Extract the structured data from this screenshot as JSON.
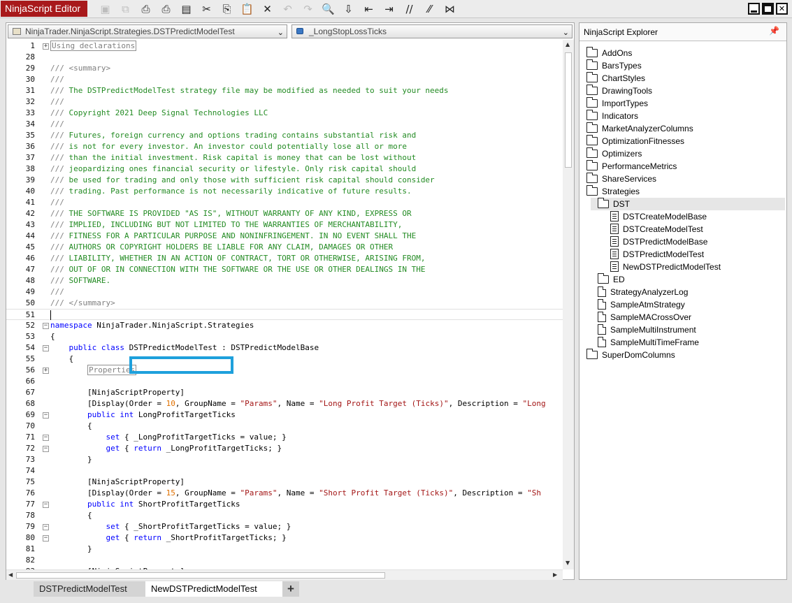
{
  "app": {
    "title": "NinjaScript Editor"
  },
  "toolbar": {
    "items": [
      {
        "name": "save-icon",
        "glyph": "▣"
      },
      {
        "name": "save-all-icon",
        "glyph": "⧉"
      },
      {
        "name": "print-icon",
        "glyph": "⎙"
      },
      {
        "name": "print-preview-icon",
        "glyph": "⎙"
      },
      {
        "name": "document-icon",
        "glyph": "▤"
      },
      {
        "name": "cut-icon",
        "glyph": "✂"
      },
      {
        "name": "copy-icon",
        "glyph": "⎘"
      },
      {
        "name": "paste-icon",
        "glyph": "📋"
      },
      {
        "name": "delete-icon",
        "glyph": "✕"
      },
      {
        "name": "undo-icon",
        "glyph": "↶"
      },
      {
        "name": "redo-icon",
        "glyph": "↷"
      },
      {
        "name": "find-icon",
        "glyph": "🔍"
      },
      {
        "name": "compile-icon",
        "glyph": "⇩"
      },
      {
        "name": "outdent-icon",
        "glyph": "⇤"
      },
      {
        "name": "indent-icon",
        "glyph": "⇥"
      },
      {
        "name": "comment-icon",
        "glyph": "//"
      },
      {
        "name": "uncomment-icon",
        "glyph": "⁄⁄"
      },
      {
        "name": "visual-studio-icon",
        "glyph": "⋈"
      }
    ]
  },
  "editor": {
    "class_combo": "NinjaTrader.NinjaScript.Strategies.DSTPredictModelTest",
    "member_combo": "_LongStopLossTicks",
    "lines": [
      {
        "n": "1",
        "fold": "+",
        "segs": [
          {
            "t": "Using declarations",
            "c": "region"
          }
        ]
      },
      {
        "n": "28",
        "segs": []
      },
      {
        "n": "29",
        "segs": [
          {
            "t": "/// <summary>",
            "c": "cgray"
          }
        ]
      },
      {
        "n": "30",
        "segs": [
          {
            "t": "///",
            "c": "cgray"
          }
        ]
      },
      {
        "n": "31",
        "segs": [
          {
            "t": "/// ",
            "c": "cgray"
          },
          {
            "t": "The DSTPredictModelTest strategy file may be modified as needed to suit your needs",
            "c": "cm"
          }
        ]
      },
      {
        "n": "32",
        "segs": [
          {
            "t": "///",
            "c": "cgray"
          }
        ]
      },
      {
        "n": "33",
        "segs": [
          {
            "t": "/// ",
            "c": "cgray"
          },
          {
            "t": "Copyright 2021 Deep Signal Technologies LLC",
            "c": "cm"
          }
        ]
      },
      {
        "n": "34",
        "segs": [
          {
            "t": "///",
            "c": "cgray"
          }
        ]
      },
      {
        "n": "35",
        "segs": [
          {
            "t": "/// ",
            "c": "cgray"
          },
          {
            "t": "Futures, foreign currency and options trading contains substantial risk and",
            "c": "cm"
          }
        ]
      },
      {
        "n": "36",
        "segs": [
          {
            "t": "/// ",
            "c": "cgray"
          },
          {
            "t": "is not for every investor. An investor could potentially lose all or more",
            "c": "cm"
          }
        ]
      },
      {
        "n": "37",
        "segs": [
          {
            "t": "/// ",
            "c": "cgray"
          },
          {
            "t": "than the initial investment. Risk capital is money that can be lost without",
            "c": "cm"
          }
        ]
      },
      {
        "n": "38",
        "segs": [
          {
            "t": "/// ",
            "c": "cgray"
          },
          {
            "t": "jeopardizing ones financial security or lifestyle. Only risk capital should",
            "c": "cm"
          }
        ]
      },
      {
        "n": "39",
        "segs": [
          {
            "t": "/// ",
            "c": "cgray"
          },
          {
            "t": "be used for trading and only those with sufficient risk capital should consider",
            "c": "cm"
          }
        ]
      },
      {
        "n": "40",
        "segs": [
          {
            "t": "/// ",
            "c": "cgray"
          },
          {
            "t": "trading. Past performance is not necessarily indicative of future results.",
            "c": "cm"
          }
        ]
      },
      {
        "n": "41",
        "segs": [
          {
            "t": "///",
            "c": "cgray"
          }
        ]
      },
      {
        "n": "42",
        "segs": [
          {
            "t": "/// ",
            "c": "cgray"
          },
          {
            "t": "THE SOFTWARE IS PROVIDED \"AS IS\", WITHOUT WARRANTY OF ANY KIND, EXPRESS OR",
            "c": "cm"
          }
        ]
      },
      {
        "n": "43",
        "segs": [
          {
            "t": "/// ",
            "c": "cgray"
          },
          {
            "t": "IMPLIED, INCLUDING BUT NOT LIMITED TO THE WARRANTIES OF MERCHANTABILITY,",
            "c": "cm"
          }
        ]
      },
      {
        "n": "44",
        "segs": [
          {
            "t": "/// ",
            "c": "cgray"
          },
          {
            "t": "FITNESS FOR A PARTICULAR PURPOSE AND NONINFRINGEMENT. IN NO EVENT SHALL THE",
            "c": "cm"
          }
        ]
      },
      {
        "n": "45",
        "segs": [
          {
            "t": "/// ",
            "c": "cgray"
          },
          {
            "t": "AUTHORS OR COPYRIGHT HOLDERS BE LIABLE FOR ANY CLAIM, DAMAGES OR OTHER",
            "c": "cm"
          }
        ]
      },
      {
        "n": "46",
        "segs": [
          {
            "t": "/// ",
            "c": "cgray"
          },
          {
            "t": "LIABILITY, WHETHER IN AN ACTION OF CONTRACT, TORT OR OTHERWISE, ARISING FROM,",
            "c": "cm"
          }
        ]
      },
      {
        "n": "47",
        "segs": [
          {
            "t": "/// ",
            "c": "cgray"
          },
          {
            "t": "OUT OF OR IN CONNECTION WITH THE SOFTWARE OR THE USE OR OTHER DEALINGS IN THE",
            "c": "cm"
          }
        ]
      },
      {
        "n": "48",
        "segs": [
          {
            "t": "/// ",
            "c": "cgray"
          },
          {
            "t": "SOFTWARE.",
            "c": "cm"
          }
        ]
      },
      {
        "n": "49",
        "segs": [
          {
            "t": "///",
            "c": "cgray"
          }
        ]
      },
      {
        "n": "50",
        "segs": [
          {
            "t": "/// </summary>",
            "c": "cgray"
          }
        ]
      },
      {
        "n": "51",
        "segs": [],
        "current": true
      },
      {
        "n": "52",
        "fold": "−",
        "segs": [
          {
            "t": "namespace",
            "c": "kw"
          },
          {
            "t": " NinjaTrader.NinjaScript.Strategies",
            "c": ""
          }
        ]
      },
      {
        "n": "53",
        "segs": [
          {
            "t": "{",
            "c": ""
          }
        ]
      },
      {
        "n": "54",
        "fold": "−",
        "segs": [
          {
            "t": "    ",
            "c": ""
          },
          {
            "t": "public",
            "c": "kw"
          },
          {
            "t": " ",
            "c": ""
          },
          {
            "t": "class",
            "c": "kw"
          },
          {
            "t": " DSTPredictModelTest : DSTPredictModelBase",
            "c": ""
          }
        ]
      },
      {
        "n": "55",
        "segs": [
          {
            "t": "    {",
            "c": ""
          }
        ]
      },
      {
        "n": "56",
        "fold": "+",
        "segs": [
          {
            "t": "        ",
            "c": ""
          },
          {
            "t": "Properties",
            "c": "region"
          }
        ]
      },
      {
        "n": "66",
        "segs": []
      },
      {
        "n": "67",
        "segs": [
          {
            "t": "        [NinjaScriptProperty]",
            "c": ""
          }
        ]
      },
      {
        "n": "68",
        "segs": [
          {
            "t": "        [Display(Order = ",
            "c": ""
          },
          {
            "t": "10",
            "c": "num"
          },
          {
            "t": ", GroupName = ",
            "c": ""
          },
          {
            "t": "\"Params\"",
            "c": "str"
          },
          {
            "t": ", Name = ",
            "c": ""
          },
          {
            "t": "\"Long Profit Target (Ticks)\"",
            "c": "str"
          },
          {
            "t": ", Description = ",
            "c": ""
          },
          {
            "t": "\"Long",
            "c": "str"
          }
        ]
      },
      {
        "n": "69",
        "fold": "−",
        "segs": [
          {
            "t": "        ",
            "c": ""
          },
          {
            "t": "public",
            "c": "kw"
          },
          {
            "t": " ",
            "c": ""
          },
          {
            "t": "int",
            "c": "kw"
          },
          {
            "t": " LongProfitTargetTicks",
            "c": ""
          }
        ]
      },
      {
        "n": "70",
        "segs": [
          {
            "t": "        {",
            "c": ""
          }
        ]
      },
      {
        "n": "71",
        "fold": "−",
        "segs": [
          {
            "t": "            ",
            "c": ""
          },
          {
            "t": "set",
            "c": "kw"
          },
          {
            "t": " { _LongProfitTargetTicks = value; }",
            "c": ""
          }
        ]
      },
      {
        "n": "72",
        "fold": "−",
        "segs": [
          {
            "t": "            ",
            "c": ""
          },
          {
            "t": "get",
            "c": "kw"
          },
          {
            "t": " { ",
            "c": ""
          },
          {
            "t": "return",
            "c": "kw"
          },
          {
            "t": " _LongProfitTargetTicks; }",
            "c": ""
          }
        ]
      },
      {
        "n": "73",
        "segs": [
          {
            "t": "        }",
            "c": ""
          }
        ]
      },
      {
        "n": "74",
        "segs": []
      },
      {
        "n": "75",
        "segs": [
          {
            "t": "        [NinjaScriptProperty]",
            "c": ""
          }
        ]
      },
      {
        "n": "76",
        "segs": [
          {
            "t": "        [Display(Order = ",
            "c": ""
          },
          {
            "t": "15",
            "c": "num"
          },
          {
            "t": ", GroupName = ",
            "c": ""
          },
          {
            "t": "\"Params\"",
            "c": "str"
          },
          {
            "t": ", Name = ",
            "c": ""
          },
          {
            "t": "\"Short Profit Target (Ticks)\"",
            "c": "str"
          },
          {
            "t": ", Description = ",
            "c": ""
          },
          {
            "t": "\"Sh",
            "c": "str"
          }
        ]
      },
      {
        "n": "77",
        "fold": "−",
        "segs": [
          {
            "t": "        ",
            "c": ""
          },
          {
            "t": "public",
            "c": "kw"
          },
          {
            "t": " ",
            "c": ""
          },
          {
            "t": "int",
            "c": "kw"
          },
          {
            "t": " ShortProfitTargetTicks",
            "c": ""
          }
        ]
      },
      {
        "n": "78",
        "segs": [
          {
            "t": "        {",
            "c": ""
          }
        ]
      },
      {
        "n": "79",
        "fold": "−",
        "segs": [
          {
            "t": "            ",
            "c": ""
          },
          {
            "t": "set",
            "c": "kw"
          },
          {
            "t": " { _ShortProfitTargetTicks = value; }",
            "c": ""
          }
        ]
      },
      {
        "n": "80",
        "fold": "−",
        "segs": [
          {
            "t": "            ",
            "c": ""
          },
          {
            "t": "get",
            "c": "kw"
          },
          {
            "t": " { ",
            "c": ""
          },
          {
            "t": "return",
            "c": "kw"
          },
          {
            "t": " _ShortProfitTargetTicks; }",
            "c": ""
          }
        ]
      },
      {
        "n": "81",
        "segs": [
          {
            "t": "        }",
            "c": ""
          }
        ]
      },
      {
        "n": "82",
        "segs": []
      },
      {
        "n": "83",
        "segs": [
          {
            "t": "        [NinjaScriptProperty]",
            "c": ""
          }
        ]
      }
    ]
  },
  "tabs": [
    {
      "label": "DSTPredictModelTest"
    },
    {
      "label": "NewDSTPredictModelTest",
      "active": true
    }
  ],
  "tab_add_label": "+",
  "explorer": {
    "title": "NinjaScript Explorer",
    "nodes": [
      {
        "label": "AddOns",
        "kind": "folder",
        "level": 0
      },
      {
        "label": "BarsTypes",
        "kind": "folder",
        "level": 0
      },
      {
        "label": "ChartStyles",
        "kind": "folder",
        "level": 0
      },
      {
        "label": "DrawingTools",
        "kind": "folder",
        "level": 0
      },
      {
        "label": "ImportTypes",
        "kind": "folder",
        "level": 0
      },
      {
        "label": "Indicators",
        "kind": "folder",
        "level": 0
      },
      {
        "label": "MarketAnalyzerColumns",
        "kind": "folder",
        "level": 0
      },
      {
        "label": "OptimizationFitnesses",
        "kind": "folder",
        "level": 0
      },
      {
        "label": "Optimizers",
        "kind": "folder",
        "level": 0
      },
      {
        "label": "PerformanceMetrics",
        "kind": "folder",
        "level": 0
      },
      {
        "label": "ShareServices",
        "kind": "folder",
        "level": 0
      },
      {
        "label": "Strategies",
        "kind": "folder",
        "level": 0
      },
      {
        "label": "DST",
        "kind": "folder",
        "level": 1,
        "selected": true
      },
      {
        "label": "DSTCreateModelBase",
        "kind": "file",
        "level": 2
      },
      {
        "label": "DSTCreateModelTest",
        "kind": "file",
        "level": 2
      },
      {
        "label": "DSTPredictModelBase",
        "kind": "file",
        "level": 2
      },
      {
        "label": "DSTPredictModelTest",
        "kind": "file",
        "level": 2
      },
      {
        "label": "NewDSTPredictModelTest",
        "kind": "file",
        "level": 2
      },
      {
        "label": "ED",
        "kind": "folder",
        "level": 1
      },
      {
        "label": "StrategyAnalyzerLog",
        "kind": "blank",
        "level": 1
      },
      {
        "label": "SampleAtmStrategy",
        "kind": "blank",
        "level": 1
      },
      {
        "label": "SampleMACrossOver",
        "kind": "blank",
        "level": 1
      },
      {
        "label": "SampleMultiInstrument",
        "kind": "blank",
        "level": 1
      },
      {
        "label": "SampleMultiTimeFrame",
        "kind": "blank",
        "level": 1
      },
      {
        "label": "SuperDomColumns",
        "kind": "folder",
        "level": 0
      }
    ]
  },
  "colors": {
    "title_bg": "#a8191b",
    "highlight_box": "#1ea0dc",
    "comment": "#238b23",
    "keyword": "#0000ff",
    "string": "#a31515",
    "number": "#e07000"
  }
}
